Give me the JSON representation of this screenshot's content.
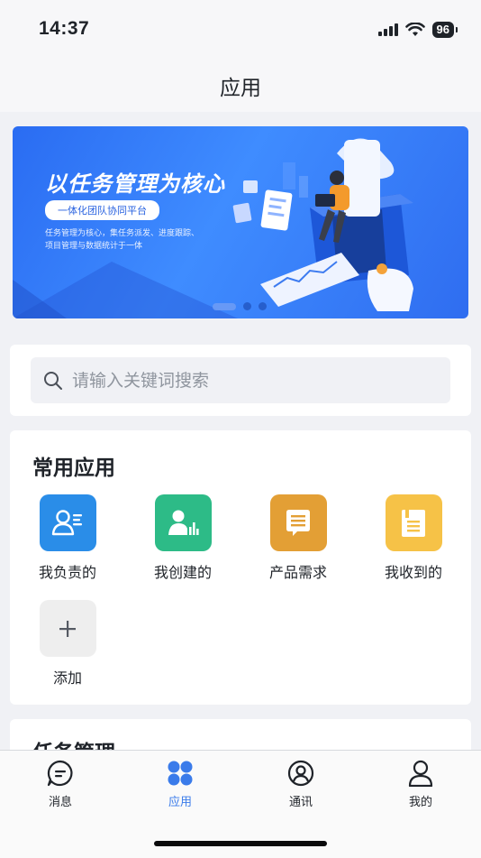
{
  "status_bar": {
    "time": "14:37",
    "battery": "96"
  },
  "nav": {
    "title": "应用"
  },
  "banner": {
    "title": "以任务管理为核心",
    "tag": "一体化团队协同平台",
    "desc_line1": "任务管理为核心，集任务派发、进度跟踪、",
    "desc_line2": "项目管理与数据统计于一体"
  },
  "search": {
    "placeholder": "请输入关键词搜索",
    "value": ""
  },
  "apps": {
    "title": "常用应用",
    "items": [
      {
        "label": "我负责的",
        "icon": "person-list-icon",
        "color": "#2a8de8"
      },
      {
        "label": "我创建的",
        "icon": "person-chart-icon",
        "color": "#2dbb87"
      },
      {
        "label": "产品需求",
        "icon": "message-doc-icon",
        "color": "#e39f35"
      },
      {
        "label": "我收到的",
        "icon": "document-icon",
        "color": "#f6c247"
      },
      {
        "label": "添加",
        "icon": "plus-icon",
        "color": "#eeeeee"
      }
    ]
  },
  "task_section": {
    "title": "任务管理"
  },
  "tabs": [
    {
      "label": "消息",
      "icon": "chat-icon"
    },
    {
      "label": "应用",
      "icon": "apps-grid-icon",
      "active": true
    },
    {
      "label": "通讯",
      "icon": "contacts-icon"
    },
    {
      "label": "我的",
      "icon": "profile-icon"
    }
  ],
  "colors": {
    "accent": "#3a7bea",
    "banner": "#2f73f0"
  }
}
